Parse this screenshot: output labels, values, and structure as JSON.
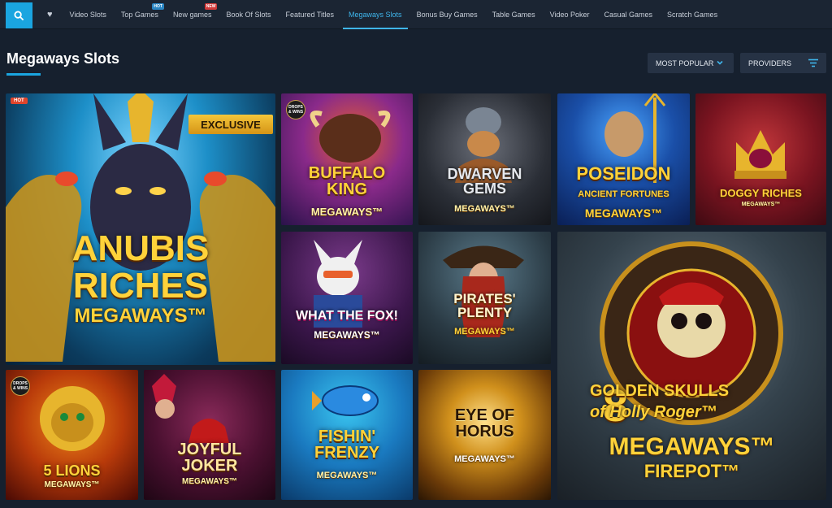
{
  "nav": {
    "items": [
      {
        "label": "Video Slots"
      },
      {
        "label": "Top Games",
        "badge": "HOT"
      },
      {
        "label": "New games",
        "badge": "NEW"
      },
      {
        "label": "Book Of Slots"
      },
      {
        "label": "Featured Titles"
      },
      {
        "label": "Megaways Slots",
        "active": true
      },
      {
        "label": "Bonus Buy Games"
      },
      {
        "label": "Table Games"
      },
      {
        "label": "Video Poker"
      },
      {
        "label": "Casual Games"
      },
      {
        "label": "Scratch Games"
      }
    ]
  },
  "page": {
    "title": "Megaways Slots",
    "sort_label": "MOST POPULAR",
    "providers_label": "PROVIDERS"
  },
  "tiles": {
    "anubis": {
      "name": "ANUBIS RICHES",
      "sub": "MEGAWAYS™",
      "tag": "HOT",
      "exclusive": "EXCLUSIVE"
    },
    "buffalo": {
      "drops": "DROPS & WINS",
      "name": "BUFFALO KING",
      "sub": "MEGAWAYS™"
    },
    "dwarven": {
      "name": "DWARVEN GEMS",
      "sub": "MEGAWAYS™"
    },
    "poseidon": {
      "name": "POSEIDON",
      "line2": "ANCIENT FORTUNES",
      "sub": "MEGAWAYS™"
    },
    "doggy": {
      "name": "DOGGY RICHES",
      "sub": "MEGAWAYS™"
    },
    "fox": {
      "name": "WHAT THE FOX!",
      "sub": "MEGAWAYS™"
    },
    "pirates": {
      "name": "PIRATES' PLENTY",
      "sub": "MEGAWAYS™"
    },
    "skulls": {
      "num": "8",
      "name": "GOLDEN SKULLS",
      "line2": "of Holly Roger™",
      "sub": "MEGAWAYS™",
      "sub2": "FIREPOT™"
    },
    "lions": {
      "drops": "DROPS & WINS",
      "name": "5 LIONS",
      "sub": "MEGAWAYS™"
    },
    "joker": {
      "name": "JOYFUL JOKER",
      "sub": "MEGAWAYS™"
    },
    "fishin": {
      "name": "FISHIN' FRENZY",
      "sub": "MEGAWAYS™"
    },
    "horus": {
      "name": "EYE OF HORUS",
      "sub": "MEGAWAYS™"
    }
  }
}
